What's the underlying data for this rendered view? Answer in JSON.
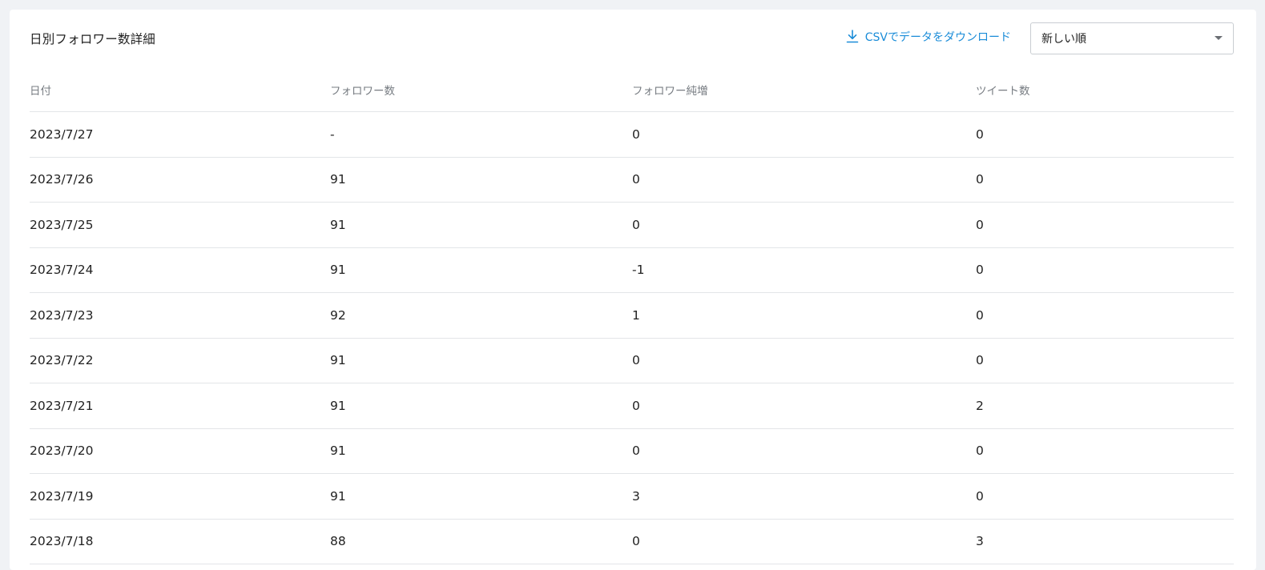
{
  "header": {
    "title": "日別フォロワー数詳細",
    "csv_label": "CSVでデータをダウンロード",
    "sort_selected": "新しい順"
  },
  "table": {
    "columns": [
      "日付",
      "フォロワー数",
      "フォロワー純増",
      "ツイート数"
    ],
    "rows": [
      [
        "2023/7/27",
        "-",
        "0",
        "0"
      ],
      [
        "2023/7/26",
        "91",
        "0",
        "0"
      ],
      [
        "2023/7/25",
        "91",
        "0",
        "0"
      ],
      [
        "2023/7/24",
        "91",
        "-1",
        "0"
      ],
      [
        "2023/7/23",
        "92",
        "1",
        "0"
      ],
      [
        "2023/7/22",
        "91",
        "0",
        "0"
      ],
      [
        "2023/7/21",
        "91",
        "0",
        "2"
      ],
      [
        "2023/7/20",
        "91",
        "0",
        "0"
      ],
      [
        "2023/7/19",
        "91",
        "3",
        "0"
      ],
      [
        "2023/7/18",
        "88",
        "0",
        "3"
      ]
    ]
  },
  "icons": {
    "download": "download-icon",
    "dropdown": "caret-down-icon"
  },
  "colors": {
    "accent": "#1a8cd8",
    "background": "#f0f2f5",
    "card": "#ffffff",
    "divider": "#e3e5e8"
  }
}
